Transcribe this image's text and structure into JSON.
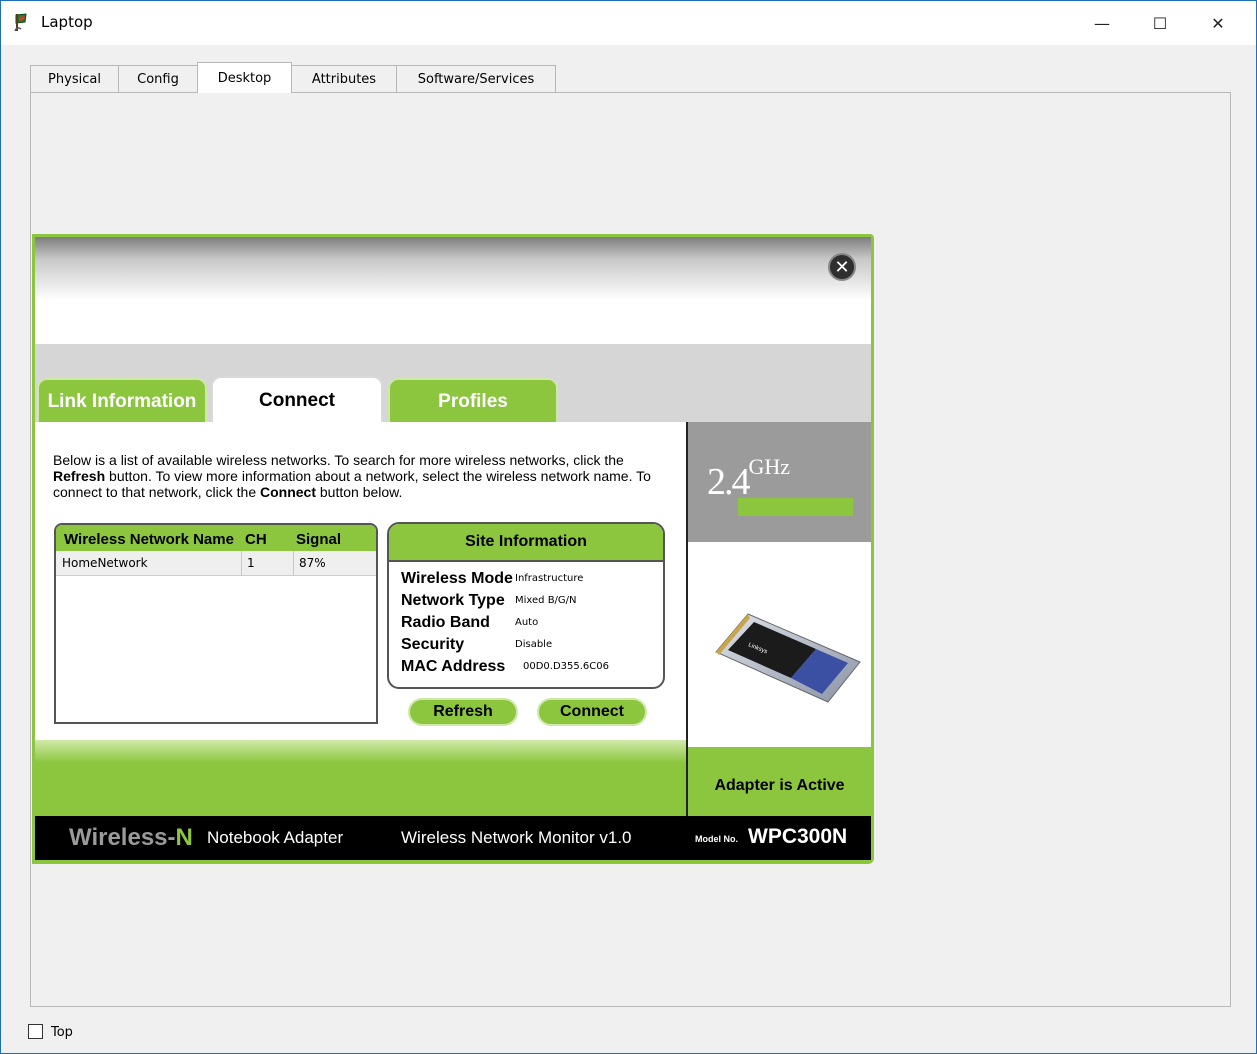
{
  "window": {
    "title": "Laptop",
    "min_glyph": "—",
    "max_glyph": "☐",
    "close_glyph": "✕"
  },
  "tabs": [
    {
      "label": "Physical"
    },
    {
      "label": "Config"
    },
    {
      "label": "Desktop",
      "active": true
    },
    {
      "label": "Attributes"
    },
    {
      "label": "Software/Services"
    }
  ],
  "monitor": {
    "close_glyph": "✕",
    "tabs": {
      "link_info": "Link Information",
      "connect": "Connect",
      "profiles": "Profiles"
    },
    "desc": {
      "p1": "Below is a list of available wireless networks. To search for more wireless networks, click the ",
      "b1": "Refresh",
      "p2": " button. To view more information about a network, select the wireless network name. To connect to that network, click the ",
      "b2": "Connect",
      "p3": " button below."
    },
    "network_list": {
      "headers": {
        "name": "Wireless Network Name",
        "ch": "CH",
        "signal": "Signal"
      },
      "rows": [
        {
          "name": "HomeNetwork",
          "ch": "1",
          "signal": "87%"
        }
      ]
    },
    "site_info": {
      "title": "Site Information",
      "wireless_mode": {
        "label": "Wireless Mode",
        "value": "Infrastructure"
      },
      "network_type": {
        "label": "Network Type",
        "value": "Mixed B/G/N"
      },
      "radio_band": {
        "label": "Radio Band",
        "value": "Auto"
      },
      "security": {
        "label": "Security",
        "value": "Disable"
      },
      "mac_address": {
        "label": "MAC Address",
        "value": "00D0.D355.6C06"
      }
    },
    "buttons": {
      "refresh": "Refresh",
      "connect": "Connect"
    },
    "ghz": {
      "num": "2.4",
      "unit": "GHz"
    },
    "adapter_status": "Adapter is Active",
    "card_brand": "Linksys",
    "footer": {
      "brand": "Wireless-",
      "brand_n": "N",
      "product": "Notebook Adapter",
      "monitor": "Wireless Network Monitor  v1.0",
      "model_label": "Model No.",
      "model": "WPC300N"
    },
    "colors": {
      "accent": "#8cc63f",
      "gray": "#9b9b9b"
    }
  },
  "top_checkbox": {
    "label": "Top",
    "checked": false
  }
}
